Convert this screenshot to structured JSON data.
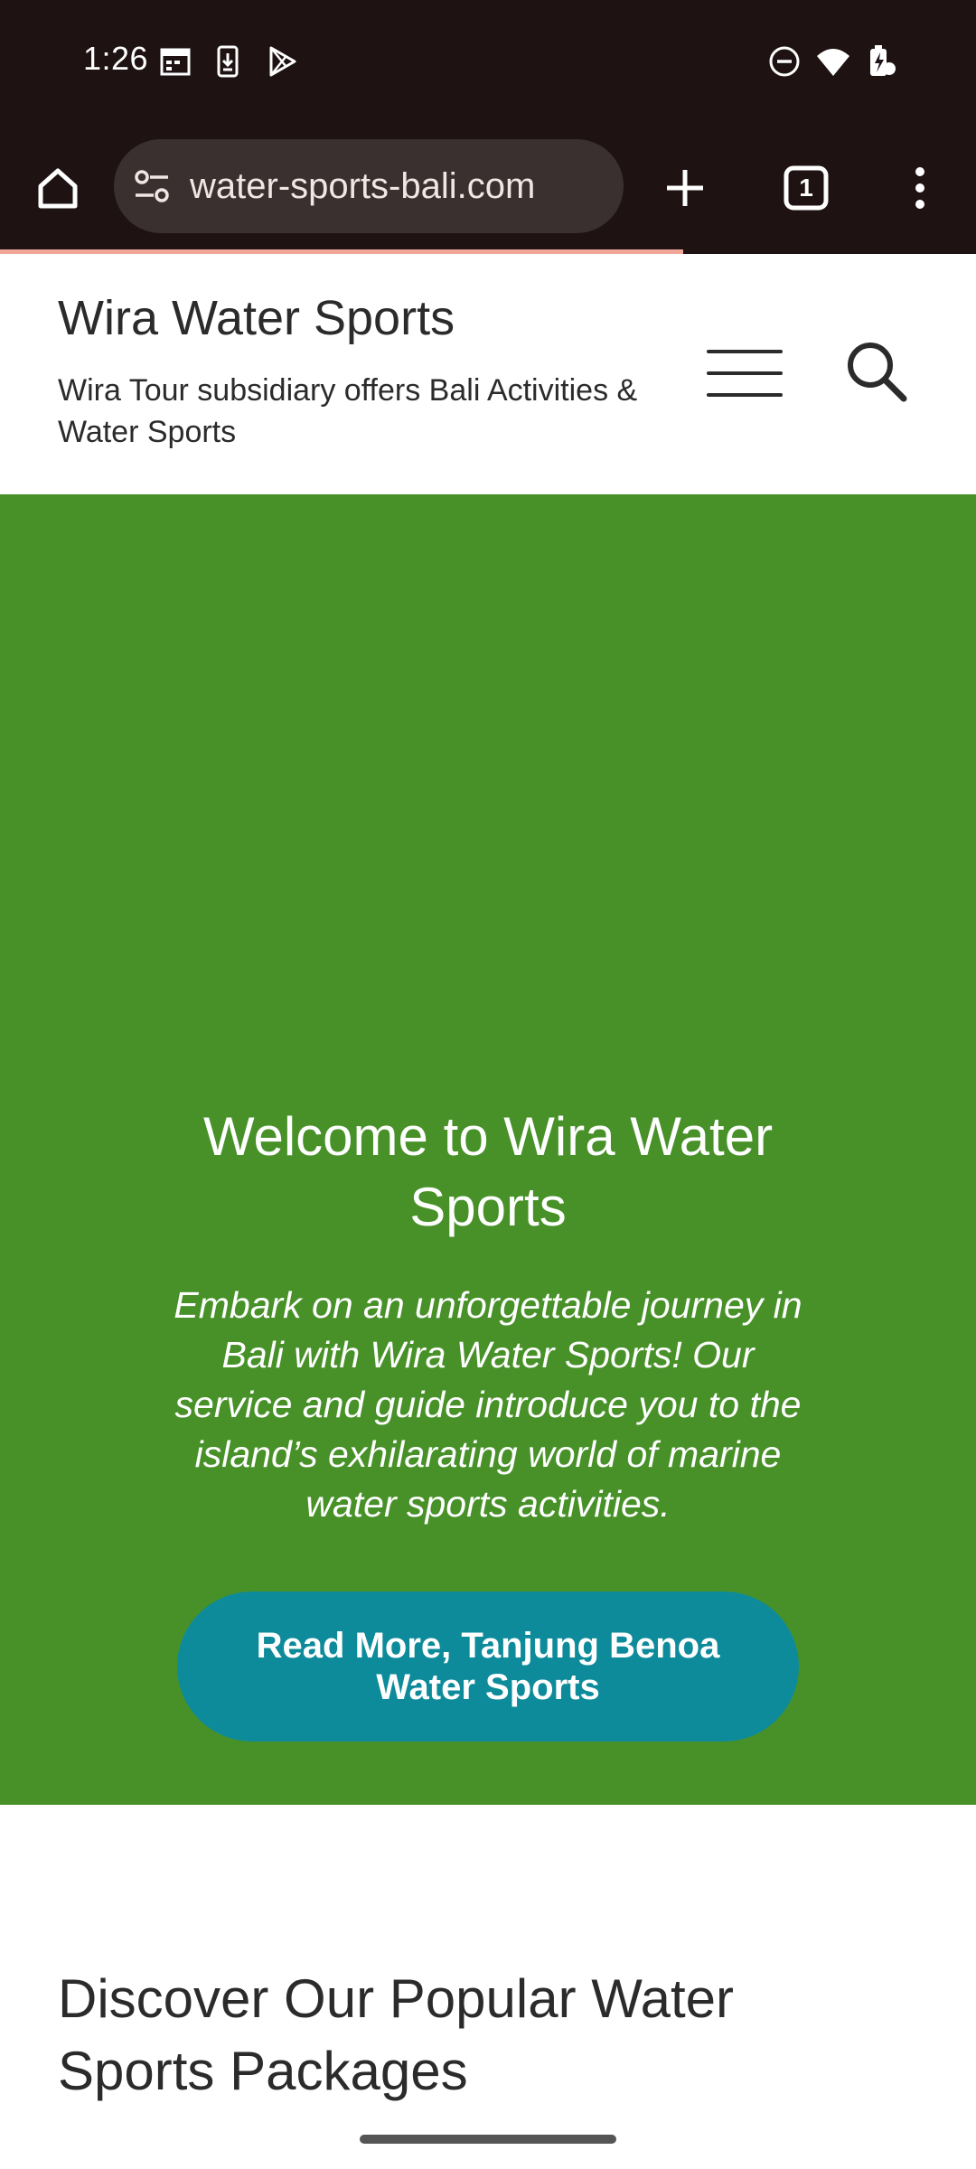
{
  "status_bar": {
    "time": "1:26",
    "left_icons": [
      "calendar-icon",
      "download-icon",
      "play-store-icon"
    ],
    "right_icons": [
      "do-not-disturb-icon",
      "wifi-icon",
      "battery-charging-icon"
    ]
  },
  "browser": {
    "url": "water-sports-bali.com",
    "tab_count": "1",
    "page_load_progress": 0.7,
    "icons": [
      "home-icon",
      "site-settings-icon",
      "new-tab-icon",
      "tab-switcher-icon",
      "more-menu-icon"
    ]
  },
  "site": {
    "title": "Wira Water Sports",
    "tagline": "Wira Tour subsidiary offers Bali Activities & Water Sports",
    "icons": [
      "menu-icon",
      "search-icon"
    ]
  },
  "hero": {
    "background_color": "#479128",
    "title": "Welcome to Wira Water Sports",
    "text": "Embark on an unforgettable journey in Bali with Wira Water Sports! Our service and guide introduce you to the island’s exhilarating world of marine water sports activities.",
    "button_label": "Read More, Tanjung Benoa Water Sports",
    "button_color": "#0e8b9b"
  },
  "section": {
    "title": "Discover Our Popular Water Sports Packages"
  }
}
